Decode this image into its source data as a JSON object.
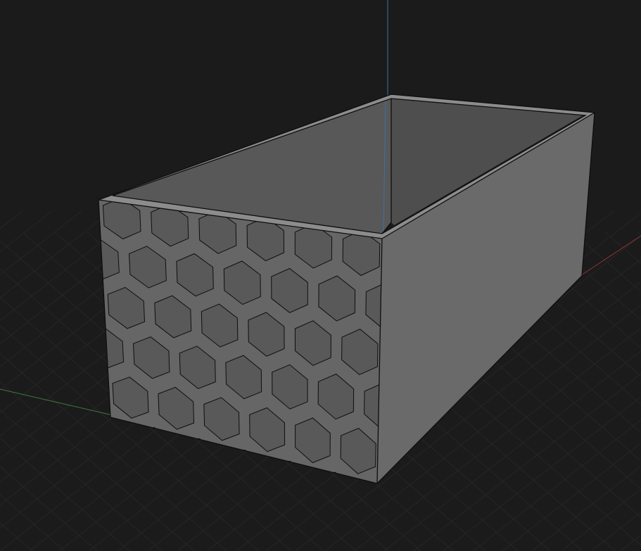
{
  "viewport": {
    "background": "#1b1b1b",
    "grid_minor_color": "#262626",
    "grid_major_color": "#2c2c2c",
    "axis_x_color": "#8a3535",
    "axis_y_color": "#3f7a3f",
    "axis_z_color": "#3f6fa6"
  },
  "model": {
    "type": "open-top box",
    "front_face_pattern": "hexagon-icon",
    "colors": {
      "front_face": "#666666",
      "side_face": "#6a6a6a",
      "rim": "#8c8c8c",
      "inner_back_wall": "#585858",
      "inner_side_wall": "#4e4e4e",
      "hexagon_fill": "#595959",
      "edge": "#0e0e0e"
    }
  }
}
